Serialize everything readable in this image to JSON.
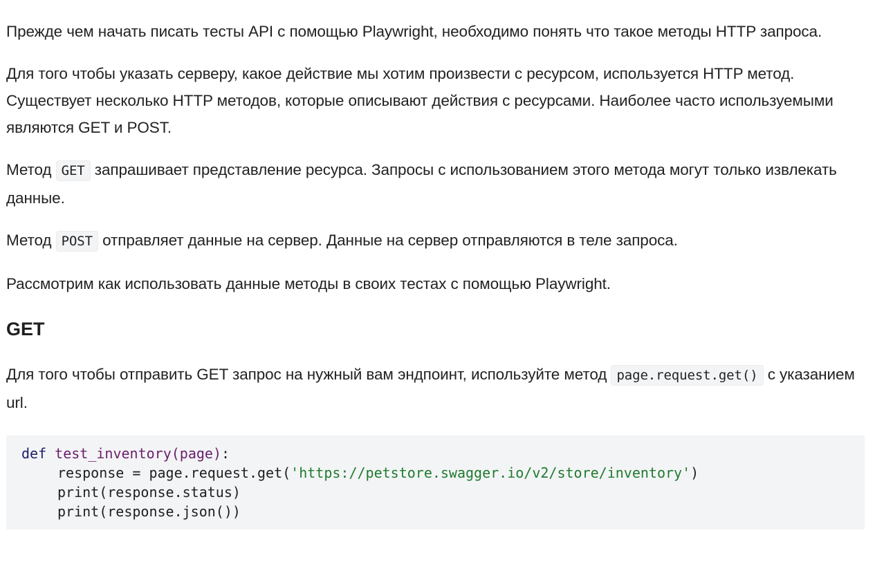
{
  "article": {
    "paragraph_1": "Прежде чем начать писать тесты API с помощью Playwright, необходимо понять что такое методы HTTP запроса.",
    "paragraph_2": "Для того чтобы указать серверу, какое действие мы хотим произвести с ресурсом, используется  HTTP метод. Существует несколько HTTP методов, которые описывают действия с ресурсами. Наиболее часто используемыми являются GET и POST.",
    "paragraph_3": {
      "before": "Метод ",
      "code": "GET",
      "after": " запрашивает представление ресурса. Запросы с использованием этого метода могут только извлекать данные."
    },
    "paragraph_4": {
      "before": "Метод ",
      "code": "POST",
      "after": "  отправляет данные на сервер. Данные на сервер отправляются в теле запроса."
    },
    "paragraph_5": "Рассмотрим как использовать данные методы в своих тестах с помощью Playwright.",
    "heading_get": "GET",
    "paragraph_6": {
      "before": "Для того чтобы отправить GET запрос на нужный вам эндпоинт, используйте метод ",
      "code": "page.request.get()",
      "after": " с указанием url."
    },
    "code_block": {
      "line_1": {
        "keyword": "def",
        "space": " ",
        "function": "test_inventory(page)",
        "tail": ":"
      },
      "line_2": {
        "before": "response = page.request.get(",
        "string": "'https://petstore.swagger.io/v2/store/inventory'",
        "after": ")"
      },
      "line_3": "print(response.status)",
      "line_4": "print(response.json())"
    }
  },
  "colors": {
    "text": "#222222",
    "code_background": "#f3f4f5",
    "keyword": "#1b1f6b",
    "function": "#6b1f6b",
    "string": "#1f7a2f"
  }
}
